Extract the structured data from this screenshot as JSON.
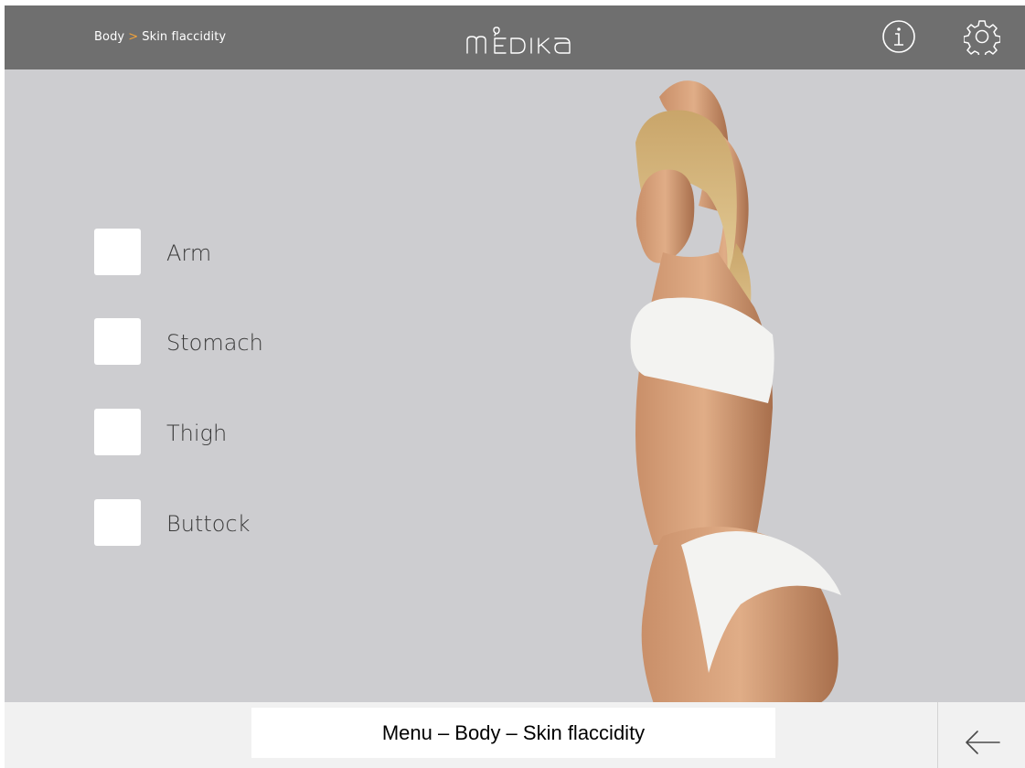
{
  "header": {
    "breadcrumb_root": "Body",
    "breadcrumb_sep": ">",
    "breadcrumb_current": "Skin flaccidity",
    "logo_text": "mEDIKA",
    "info_icon": "info-icon",
    "settings_icon": "gear-icon"
  },
  "options": [
    {
      "label": "Arm",
      "checked": false
    },
    {
      "label": "Stomach",
      "checked": false
    },
    {
      "label": "Thigh",
      "checked": false
    },
    {
      "label": "Buttock",
      "checked": false
    }
  ],
  "footer": {
    "caption": "Menu – Body – Skin flaccidity",
    "back_icon": "arrow-left-icon"
  },
  "colors": {
    "header_bg": "#6f6f6f",
    "content_bg": "#cdcdd0",
    "footer_bg": "#f1f1f1",
    "breadcrumb_separator": "#f2a23a"
  }
}
